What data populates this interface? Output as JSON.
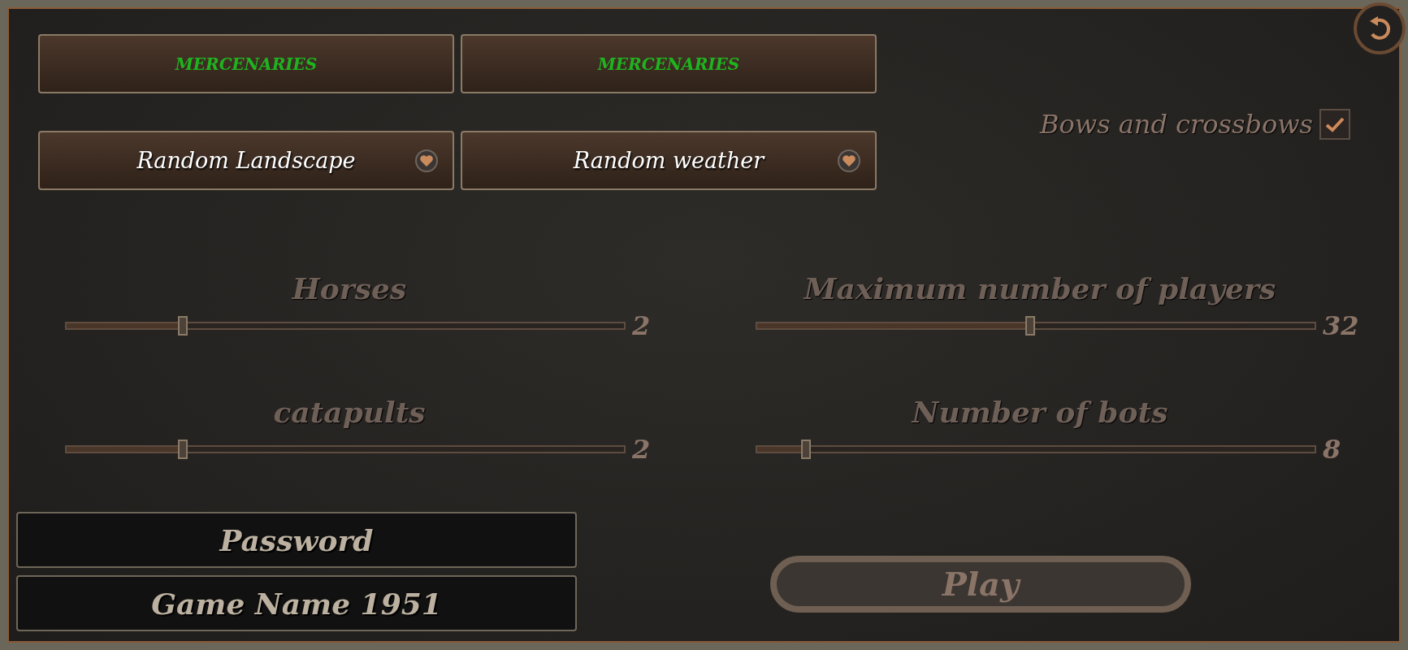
{
  "faction_buttons": [
    {
      "label": "MERCENARIES"
    },
    {
      "label": "MERCENARIES"
    }
  ],
  "option_buttons": [
    {
      "label": "Random Landscape"
    },
    {
      "label": "Random weather"
    }
  ],
  "bows_and_crossbows": {
    "label": "Bows and crossbows",
    "checked": true
  },
  "sliders": [
    {
      "label": "Horses",
      "level": 0.21,
      "reading": "2"
    },
    {
      "label": "Maximum number of players",
      "level": 0.49,
      "reading": "32"
    },
    {
      "label": "catapults",
      "level": 0.21,
      "reading": "2"
    },
    {
      "label": "Number of bots",
      "level": 0.09,
      "reading": "8"
    }
  ],
  "password_field": {
    "placeholder": "Password"
  },
  "game_name_field": {
    "value": "Game Name 1951"
  },
  "play_button": {
    "label": "Play"
  }
}
